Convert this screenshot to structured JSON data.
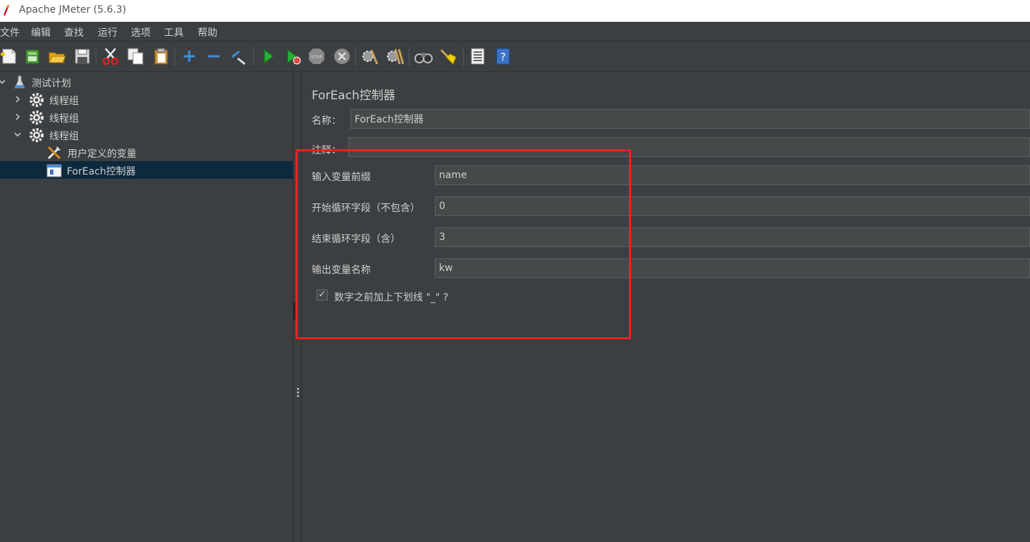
{
  "window": {
    "title": "Apache JMeter (5.6.3)",
    "icon": "jmeter-feather-icon"
  },
  "menu": [
    "文件",
    "编辑",
    "查找",
    "运行",
    "选项",
    "工具",
    "帮助"
  ],
  "toolbar": [
    "new-icon",
    "templates-icon",
    "open-icon",
    "save-icon",
    "cut-icon",
    "copy-icon",
    "paste-icon",
    "expand-icon",
    "collapse-icon",
    "toggle-icon",
    "start-icon",
    "start-no-pauses-icon",
    "stop-icon",
    "shutdown-icon",
    "clear-icon",
    "clear-all-icon",
    "search-icon",
    "reset-search-icon",
    "function-helper-icon",
    "help-icon"
  ],
  "tree": {
    "items": [
      {
        "label": "测试计划",
        "icon": "test-plan-icon",
        "expanded": true
      },
      {
        "label": "线程组",
        "icon": "gear-icon",
        "expanded": false
      },
      {
        "label": "线程组",
        "icon": "gear-icon",
        "expanded": false
      },
      {
        "label": "线程组",
        "icon": "gear-icon",
        "expanded": true
      },
      {
        "label": "用户定义的变量",
        "icon": "tools-icon"
      },
      {
        "label": "ForEach控制器",
        "icon": "controller-icon",
        "selected": true
      }
    ]
  },
  "panel": {
    "title": "ForEach控制器",
    "name_label": "名称：",
    "name_value": "ForEach控制器",
    "comment_label": "注释：",
    "comment_value": "",
    "input_prefix_label": "输入变量前缀",
    "input_prefix_value": "name",
    "start_index_label": "开始循环字段（不包含）",
    "start_index_value": "0",
    "end_index_label": "结束循环字段（含）",
    "end_index_value": "3",
    "output_var_label": "输出变量名称",
    "output_var_value": "kw",
    "underscore_label": "数字之前加上下划线 \"_\" ?",
    "underscore_checked": true
  },
  "colors": {
    "background": "#3c3f41",
    "selected_row": "#0d293e",
    "annotation": "#e8231f",
    "input_bg": "#45494a"
  }
}
